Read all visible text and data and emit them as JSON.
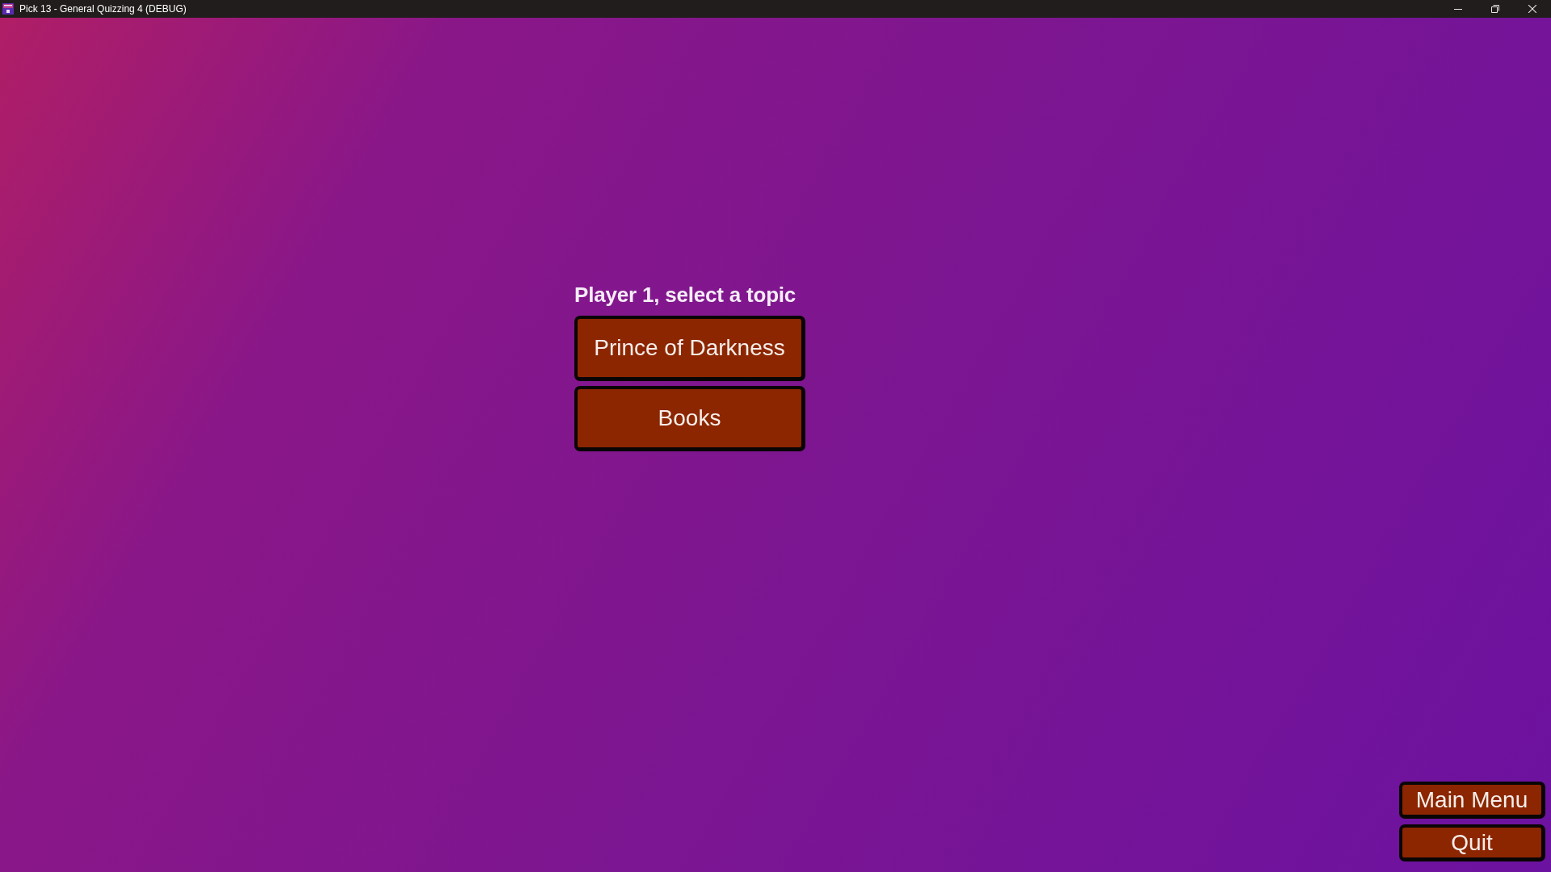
{
  "window": {
    "title": "Pick 13 - General Quizzing 4 (DEBUG)"
  },
  "prompt": "Player 1, select a topic",
  "topics": [
    {
      "label": "Prince of Darkness"
    },
    {
      "label": "Books"
    }
  ],
  "footer_buttons": [
    "Main Menu",
    "Quit"
  ]
}
